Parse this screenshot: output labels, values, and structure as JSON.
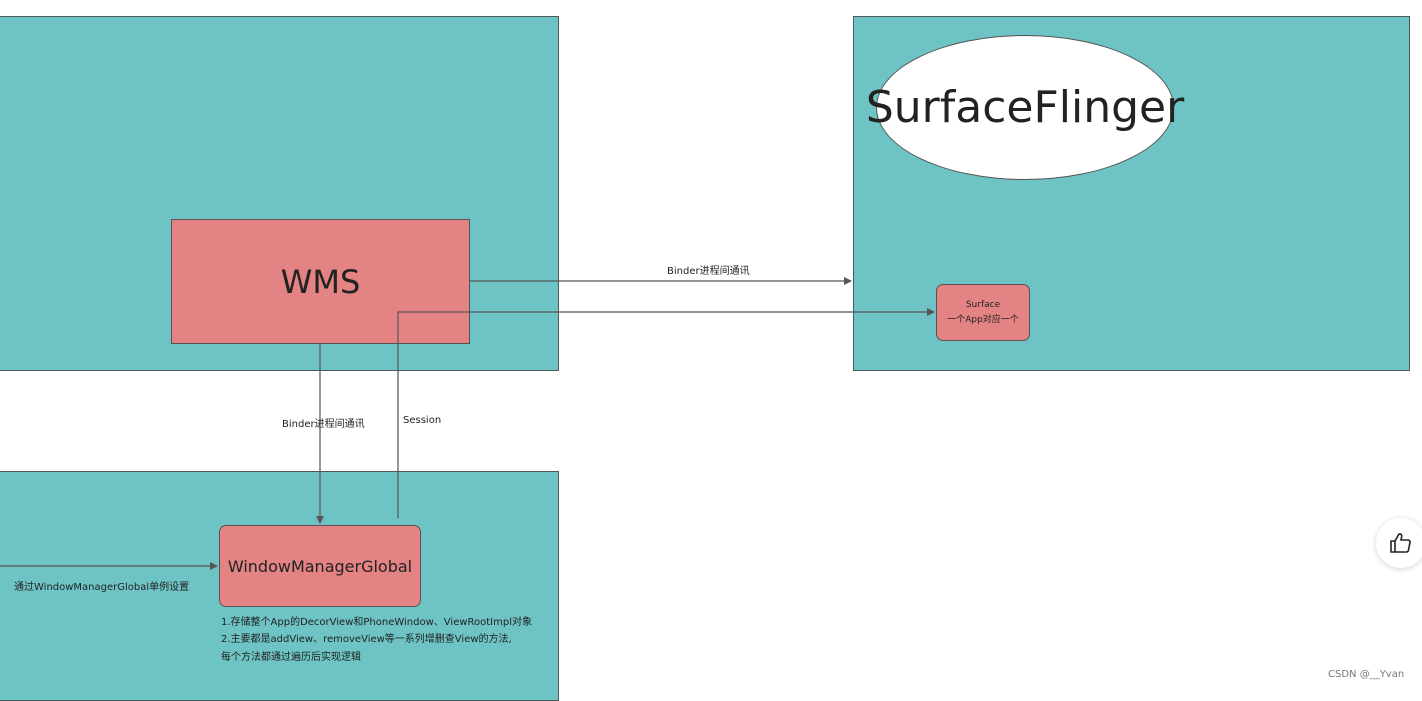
{
  "nodes": {
    "wms": "WMS",
    "surfaceflinger": "SurfaceFlinger",
    "surface_title": "Surface",
    "surface_desc": "一个App对应一个",
    "window_manager_global": "WindowManagerGlobal"
  },
  "edges": {
    "wms_to_surfaceflinger": "Binder进程间通讯",
    "wms_to_wmg": "Binder进程间通讯",
    "session": "Session",
    "left_in": "通过WindowManagerGlobal单例设置"
  },
  "notes": {
    "line1": "1.存储整个App的DecorView和PhoneWindow、ViewRootImpl对象",
    "line2": "2.主要都是addView、removeView等一系列增删查View的方法,",
    "line3": "每个方法都通过遍历后实现逻辑"
  },
  "ui": {
    "like_icon": "thumbs-up-icon",
    "watermark": "CSDN @__Yvan"
  },
  "colors": {
    "panel": "#6ec4c4",
    "node": "#e48383",
    "ellipse": "#ffffff",
    "line": "#555555"
  }
}
